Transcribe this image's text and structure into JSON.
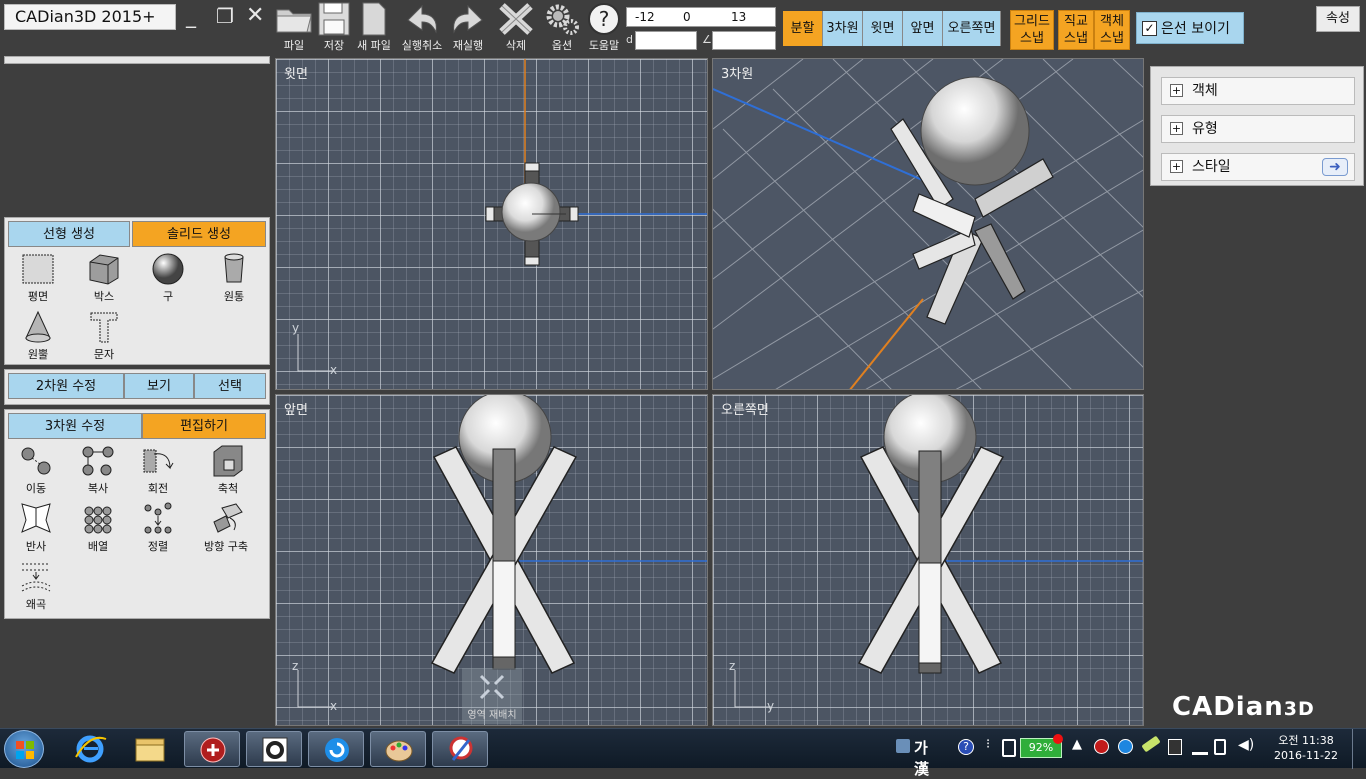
{
  "app": {
    "title": "CADian3D 2015+",
    "logo_main": "CADian",
    "logo_suffix": "3D"
  },
  "window_controls": [
    "_",
    "❐",
    "✕"
  ],
  "toolbar": {
    "file": "파일",
    "save": "저장",
    "new_file": "새 파일",
    "undo": "실행취소",
    "redo": "재실행",
    "delete": "삭제",
    "options": "옵션",
    "help": "도움말"
  },
  "coords": {
    "x": "-12",
    "y": "0",
    "z": "13",
    "distance_label": "d",
    "angle_label": "∠",
    "distance": "",
    "angle": ""
  },
  "view_buttons": {
    "split": "분할",
    "three_d": "3차원",
    "top": "윗면",
    "front": "앞면",
    "right": "오른쪽면"
  },
  "snap_buttons": {
    "grid": [
      "그리드",
      "스냅"
    ],
    "ortho": [
      "직교",
      "스냅"
    ],
    "object": [
      "객체",
      "스냅"
    ]
  },
  "hidden_lines": {
    "label": "은선 보이기",
    "checked": true
  },
  "properties_button": "속성",
  "panel_create": {
    "tabs": {
      "linear": "선형 생성",
      "solid": "솔리드 생성"
    },
    "tools": {
      "plane": "평면",
      "box": "박스",
      "sphere": "구",
      "cylinder": "원통",
      "cone": "원뿔",
      "text": "문자"
    }
  },
  "panel_mid": {
    "edit2d": "2차원 수정",
    "view": "보기",
    "select": "선택"
  },
  "panel_edit": {
    "tabs": {
      "edit3d": "3차원 수정",
      "editing": "편집하기"
    },
    "tools": {
      "move": "이동",
      "copy": "복사",
      "rotate": "회전",
      "scale": "축척",
      "mirror": "반사",
      "array": "배열",
      "align": "정렬",
      "direction": "방향 구축",
      "warp": "왜곡"
    }
  },
  "viewports": {
    "top": "윗면",
    "three_d": "3차원",
    "front": "앞면",
    "right": "오른쪽면"
  },
  "axes": {
    "x": "x",
    "y": "y",
    "z": "z"
  },
  "right_panel": {
    "object": "객체",
    "type": "유형",
    "style": "스타일",
    "plus": "+",
    "arrow": "➜"
  },
  "region_tool": "영역 재배치",
  "taskbar": {
    "ime": "가 漢",
    "battery": "92%",
    "clock_time": "오전 11:38",
    "clock_date": "2016-11-22"
  }
}
